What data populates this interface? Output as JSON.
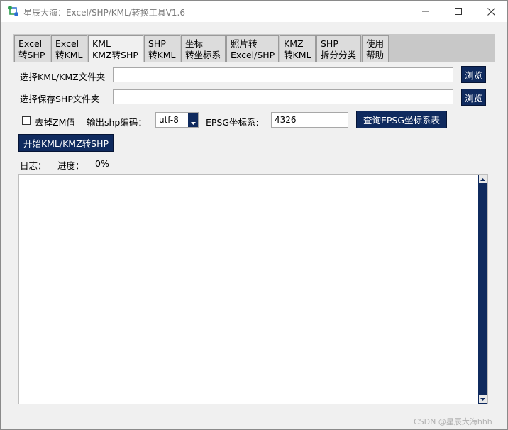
{
  "window": {
    "title": "星辰大海：Excel/SHP/KML/转换工具V1.6"
  },
  "tabs": [
    {
      "line1": "Excel",
      "line2": "转SHP"
    },
    {
      "line1": "Excel",
      "line2": "转KML"
    },
    {
      "line1": "KML",
      "line2": "KMZ转SHP"
    },
    {
      "line1": "SHP",
      "line2": "转KML"
    },
    {
      "line1": "坐标",
      "line2": "转坐标系"
    },
    {
      "line1": "照片转",
      "line2": "Excel/SHP"
    },
    {
      "line1": "KMZ",
      "line2": "转KML"
    },
    {
      "line1": "SHP",
      "line2": "拆分分类"
    },
    {
      "line1": "使用",
      "line2": "帮助"
    }
  ],
  "form": {
    "input_folder_label": "选择KML/KMZ文件夹",
    "input_folder_value": "",
    "output_folder_label": "选择保存SHP文件夹",
    "output_folder_value": "",
    "browse_label": "浏览",
    "remove_zm_label": "去掉ZM值",
    "encoding_label": "输出shp编码：",
    "encoding_value": "utf-8",
    "epsg_label": "EPSG坐标系:",
    "epsg_value": "4326",
    "query_epsg_label": "查询EPSG坐标系表",
    "start_label": "开始KML/KMZ转SHP",
    "log_label": "日志：",
    "progress_label": "进度：",
    "progress_value": "0%"
  },
  "footer": {
    "watermark": "CSDN @星辰大海hhh"
  },
  "colors": {
    "navy": "#0f2a5e",
    "tab_bg": "#dcdcdc",
    "window_bg": "#f0f0f0"
  }
}
